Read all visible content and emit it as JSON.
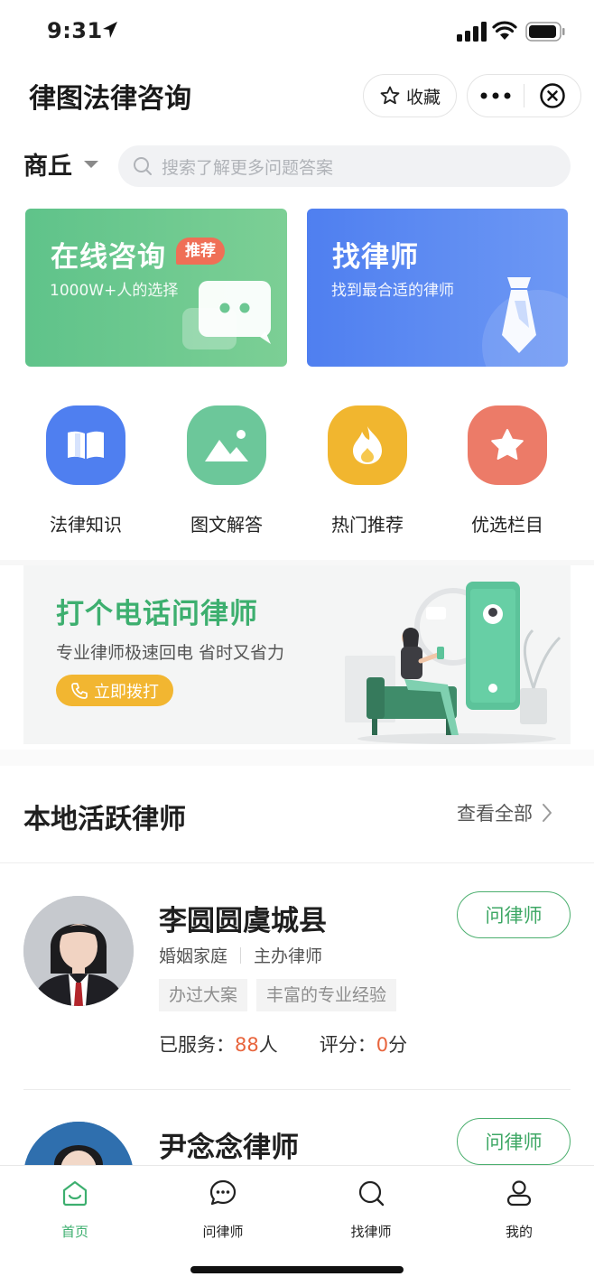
{
  "status_bar": {
    "time": "9:31"
  },
  "header": {
    "title": "律图法律咨询",
    "favorite_label": "收藏"
  },
  "location": {
    "city": "商丘"
  },
  "search": {
    "placeholder": "搜索了解更多问题答案"
  },
  "cards": [
    {
      "title": "在线咨询",
      "badge": "推荐",
      "subtitle": "1000W+人的选择",
      "color": "#6ccb8f"
    },
    {
      "title": "找律师",
      "subtitle": "找到最合适的律师",
      "color": "#5a88f2"
    }
  ],
  "categories": [
    {
      "label": "法律知识",
      "icon": "book-icon",
      "color": "#4f7ff0"
    },
    {
      "label": "图文解答",
      "icon": "image-icon",
      "color": "#6cc79a"
    },
    {
      "label": "热门推荐",
      "icon": "fire-icon",
      "color": "#f1b62f"
    },
    {
      "label": "优选栏目",
      "icon": "star-icon",
      "color": "#ec7b68"
    }
  ],
  "banner": {
    "title": "打个电话问律师",
    "subtitle": "专业律师极速回电 省时又省力",
    "button": "立即拨打"
  },
  "lawyers_section": {
    "title": "本地活跃律师",
    "view_all": "查看全部"
  },
  "lawyers": [
    {
      "name": "李圆圆虞城县",
      "field": "婚姻家庭",
      "role": "主办律师",
      "tags": [
        "办过大案",
        "丰富的专业经验"
      ],
      "served_label": "已服务：",
      "served_count": "88",
      "served_unit": "人",
      "rating_label": "评分：",
      "rating": "0",
      "rating_unit": "分",
      "ask_label": "问律师"
    },
    {
      "name": "尹念念律师",
      "ask_label": "问律师"
    }
  ],
  "tab_bar": [
    {
      "label": "首页",
      "icon": "home-icon",
      "active": true
    },
    {
      "label": "问律师",
      "icon": "chat-icon",
      "active": false
    },
    {
      "label": "找律师",
      "icon": "search-icon",
      "active": false
    },
    {
      "label": "我的",
      "icon": "user-icon",
      "active": false
    }
  ],
  "colors": {
    "accent": "#3daf6f",
    "highlight": "#e8643c",
    "call_button": "#f2b631"
  }
}
